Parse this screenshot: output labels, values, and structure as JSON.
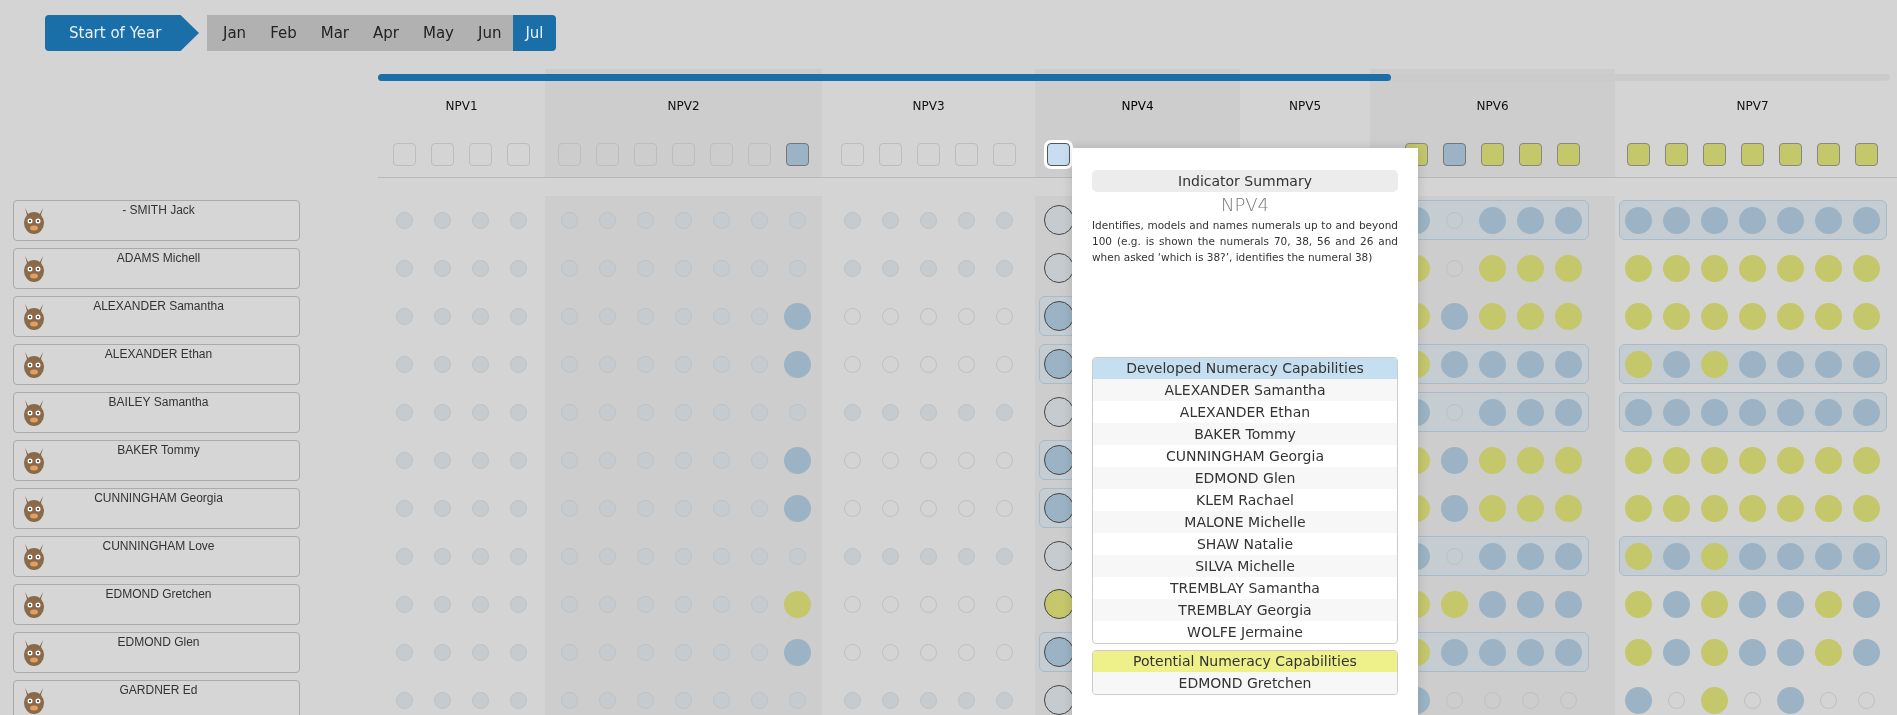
{
  "periods": [
    {
      "label": "Start of Year",
      "kind": "start",
      "selected": false
    },
    {
      "label": "Jan",
      "kind": "month",
      "selected": false
    },
    {
      "label": "Feb",
      "kind": "month",
      "selected": false
    },
    {
      "label": "Mar",
      "kind": "month",
      "selected": false
    },
    {
      "label": "Apr",
      "kind": "month",
      "selected": false
    },
    {
      "label": "May",
      "kind": "month",
      "selected": false
    },
    {
      "label": "Jun",
      "kind": "month",
      "selected": false
    },
    {
      "label": "Jul",
      "kind": "month",
      "selected": true
    }
  ],
  "progress": {
    "level": 0.67
  },
  "indicators": [
    {
      "label": "NPV1",
      "selected": false,
      "checks": [
        {
          "kind": "empty"
        },
        {
          "kind": "empty"
        },
        {
          "kind": "empty"
        },
        {
          "kind": "empty"
        }
      ]
    },
    {
      "label": "NPV2",
      "selected": false,
      "checks": [
        {
          "kind": "empty"
        },
        {
          "kind": "empty"
        },
        {
          "kind": "empty"
        },
        {
          "kind": "empty"
        },
        {
          "kind": "empty"
        },
        {
          "kind": "empty"
        },
        {
          "kind": "developed"
        }
      ]
    },
    {
      "label": "NPV3",
      "selected": false,
      "checks": [
        {
          "kind": "empty"
        },
        {
          "kind": "empty"
        },
        {
          "kind": "empty"
        },
        {
          "kind": "empty"
        },
        {
          "kind": "empty"
        }
      ]
    },
    {
      "label": "NPV4",
      "selected": true,
      "checks": [
        {
          "kind": "empty"
        }
      ]
    },
    {
      "label": "NPV5",
      "selected": false
    },
    {
      "label": "NPV6",
      "selected": false,
      "checks": [
        {
          "kind": "potential"
        },
        {
          "kind": "developed"
        },
        {
          "kind": "potential"
        },
        {
          "kind": "potential"
        },
        {
          "kind": "potential"
        }
      ]
    },
    {
      "label": "NPV7",
      "selected": false,
      "checks": [
        {
          "kind": "potential"
        },
        {
          "kind": "potential"
        },
        {
          "kind": "potential"
        },
        {
          "kind": "potential"
        },
        {
          "kind": "potential"
        },
        {
          "kind": "potential"
        },
        {
          "kind": "potential"
        }
      ]
    }
  ],
  "students": [
    {
      "name": "- SMITH Jack",
      "groups": [
        {
          "band": false,
          "dots": [
            {
              "kind": "inactive"
            },
            {
              "kind": "inactive"
            },
            {
              "kind": "inactive"
            },
            {
              "kind": "inactive"
            }
          ]
        },
        {
          "band": false,
          "dots": [
            {
              "kind": "inactive"
            },
            {
              "kind": "inactive"
            },
            {
              "kind": "inactive"
            },
            {
              "kind": "inactive"
            },
            {
              "kind": "inactive"
            },
            {
              "kind": "inactive"
            },
            {
              "kind": "inactive"
            }
          ]
        },
        {
          "band": false,
          "dots": [
            {
              "kind": "inactive"
            },
            {
              "kind": "inactive"
            },
            {
              "kind": "inactive"
            },
            {
              "kind": "inactive"
            },
            {
              "kind": "inactive"
            }
          ]
        },
        {
          "band": false,
          "dots": [
            {
              "kind": "unassessed"
            }
          ]
        },
        {
          "band": true,
          "dots": [
            {
              "kind": "developed"
            },
            {
              "kind": "empty"
            },
            {
              "kind": "developed"
            },
            {
              "kind": "developed"
            },
            {
              "kind": "developed"
            }
          ]
        },
        {
          "band": true,
          "dots": [
            {
              "kind": "developed"
            },
            {
              "kind": "developed"
            },
            {
              "kind": "developed"
            },
            {
              "kind": "developed"
            },
            {
              "kind": "developed"
            },
            {
              "kind": "developed"
            },
            {
              "kind": "developed"
            }
          ]
        }
      ]
    },
    {
      "name": "ADAMS Michell",
      "groups": [
        {
          "band": false,
          "dots": [
            {
              "kind": "inactive"
            },
            {
              "kind": "inactive"
            },
            {
              "kind": "inactive"
            },
            {
              "kind": "inactive"
            }
          ]
        },
        {
          "band": false,
          "dots": [
            {
              "kind": "inactive"
            },
            {
              "kind": "inactive"
            },
            {
              "kind": "inactive"
            },
            {
              "kind": "inactive"
            },
            {
              "kind": "inactive"
            },
            {
              "kind": "inactive"
            },
            {
              "kind": "inactive"
            }
          ]
        },
        {
          "band": false,
          "dots": [
            {
              "kind": "inactive"
            },
            {
              "kind": "inactive"
            },
            {
              "kind": "inactive"
            },
            {
              "kind": "inactive"
            },
            {
              "kind": "inactive"
            }
          ]
        },
        {
          "band": false,
          "dots": [
            {
              "kind": "unassessed"
            }
          ]
        },
        {
          "band": false,
          "dots": [
            {
              "kind": "potential"
            },
            {
              "kind": "empty"
            },
            {
              "kind": "potential"
            },
            {
              "kind": "potential"
            },
            {
              "kind": "potential"
            }
          ]
        },
        {
          "band": false,
          "dots": [
            {
              "kind": "potential"
            },
            {
              "kind": "potential"
            },
            {
              "kind": "potential"
            },
            {
              "kind": "potential"
            },
            {
              "kind": "potential"
            },
            {
              "kind": "potential"
            },
            {
              "kind": "potential"
            }
          ]
        }
      ]
    },
    {
      "name": "ALEXANDER Samantha",
      "groups": [
        {
          "band": false,
          "dots": [
            {
              "kind": "inactive"
            },
            {
              "kind": "inactive"
            },
            {
              "kind": "inactive"
            },
            {
              "kind": "inactive"
            }
          ]
        },
        {
          "band": false,
          "dots": [
            {
              "kind": "inactive"
            },
            {
              "kind": "inactive"
            },
            {
              "kind": "inactive"
            },
            {
              "kind": "inactive"
            },
            {
              "kind": "inactive"
            },
            {
              "kind": "inactive"
            },
            {
              "kind": "developed"
            }
          ]
        },
        {
          "band": false,
          "dots": [
            {
              "kind": "empty"
            },
            {
              "kind": "empty"
            },
            {
              "kind": "empty"
            },
            {
              "kind": "empty"
            },
            {
              "kind": "empty"
            }
          ]
        },
        {
          "band": true,
          "dots": [
            {
              "kind": "developed"
            }
          ]
        },
        {
          "band": false,
          "dots": [
            {
              "kind": "potential"
            },
            {
              "kind": "developed"
            },
            {
              "kind": "potential"
            },
            {
              "kind": "potential"
            },
            {
              "kind": "potential"
            }
          ]
        },
        {
          "band": false,
          "dots": [
            {
              "kind": "potential"
            },
            {
              "kind": "potential"
            },
            {
              "kind": "potential"
            },
            {
              "kind": "potential"
            },
            {
              "kind": "potential"
            },
            {
              "kind": "potential"
            },
            {
              "kind": "potential"
            }
          ]
        }
      ]
    },
    {
      "name": "ALEXANDER Ethan",
      "groups": [
        {
          "band": false,
          "dots": [
            {
              "kind": "inactive"
            },
            {
              "kind": "inactive"
            },
            {
              "kind": "inactive"
            },
            {
              "kind": "inactive"
            }
          ]
        },
        {
          "band": false,
          "dots": [
            {
              "kind": "inactive"
            },
            {
              "kind": "inactive"
            },
            {
              "kind": "inactive"
            },
            {
              "kind": "inactive"
            },
            {
              "kind": "inactive"
            },
            {
              "kind": "inactive"
            },
            {
              "kind": "developed"
            }
          ]
        },
        {
          "band": false,
          "dots": [
            {
              "kind": "empty"
            },
            {
              "kind": "empty"
            },
            {
              "kind": "empty"
            },
            {
              "kind": "empty"
            },
            {
              "kind": "empty"
            }
          ]
        },
        {
          "band": true,
          "dots": [
            {
              "kind": "developed"
            }
          ]
        },
        {
          "band": true,
          "dots": [
            {
              "kind": "potential"
            },
            {
              "kind": "developed"
            },
            {
              "kind": "developed"
            },
            {
              "kind": "developed"
            },
            {
              "kind": "developed"
            }
          ]
        },
        {
          "band": true,
          "dots": [
            {
              "kind": "potential"
            },
            {
              "kind": "developed"
            },
            {
              "kind": "potential"
            },
            {
              "kind": "developed"
            },
            {
              "kind": "developed"
            },
            {
              "kind": "developed"
            },
            {
              "kind": "developed"
            }
          ]
        }
      ]
    },
    {
      "name": "BAILEY Samantha",
      "groups": [
        {
          "band": false,
          "dots": [
            {
              "kind": "inactive"
            },
            {
              "kind": "inactive"
            },
            {
              "kind": "inactive"
            },
            {
              "kind": "inactive"
            }
          ]
        },
        {
          "band": false,
          "dots": [
            {
              "kind": "inactive"
            },
            {
              "kind": "inactive"
            },
            {
              "kind": "inactive"
            },
            {
              "kind": "inactive"
            },
            {
              "kind": "inactive"
            },
            {
              "kind": "inactive"
            },
            {
              "kind": "inactive"
            }
          ]
        },
        {
          "band": false,
          "dots": [
            {
              "kind": "inactive"
            },
            {
              "kind": "inactive"
            },
            {
              "kind": "inactive"
            },
            {
              "kind": "inactive"
            },
            {
              "kind": "inactive"
            }
          ]
        },
        {
          "band": false,
          "dots": [
            {
              "kind": "unassessed"
            }
          ]
        },
        {
          "band": true,
          "dots": [
            {
              "kind": "developed"
            },
            {
              "kind": "empty"
            },
            {
              "kind": "developed"
            },
            {
              "kind": "developed"
            },
            {
              "kind": "developed"
            }
          ]
        },
        {
          "band": true,
          "dots": [
            {
              "kind": "developed"
            },
            {
              "kind": "developed"
            },
            {
              "kind": "developed"
            },
            {
              "kind": "developed"
            },
            {
              "kind": "developed"
            },
            {
              "kind": "developed"
            },
            {
              "kind": "developed"
            }
          ]
        }
      ]
    },
    {
      "name": "BAKER Tommy",
      "groups": [
        {
          "band": false,
          "dots": [
            {
              "kind": "inactive"
            },
            {
              "kind": "inactive"
            },
            {
              "kind": "inactive"
            },
            {
              "kind": "inactive"
            }
          ]
        },
        {
          "band": false,
          "dots": [
            {
              "kind": "inactive"
            },
            {
              "kind": "inactive"
            },
            {
              "kind": "inactive"
            },
            {
              "kind": "inactive"
            },
            {
              "kind": "inactive"
            },
            {
              "kind": "inactive"
            },
            {
              "kind": "developed"
            }
          ]
        },
        {
          "band": false,
          "dots": [
            {
              "kind": "empty"
            },
            {
              "kind": "empty"
            },
            {
              "kind": "empty"
            },
            {
              "kind": "empty"
            },
            {
              "kind": "empty"
            }
          ]
        },
        {
          "band": true,
          "dots": [
            {
              "kind": "developed"
            }
          ]
        },
        {
          "band": false,
          "dots": [
            {
              "kind": "potential"
            },
            {
              "kind": "developed"
            },
            {
              "kind": "potential"
            },
            {
              "kind": "potential"
            },
            {
              "kind": "potential"
            }
          ]
        },
        {
          "band": false,
          "dots": [
            {
              "kind": "potential"
            },
            {
              "kind": "potential"
            },
            {
              "kind": "potential"
            },
            {
              "kind": "potential"
            },
            {
              "kind": "potential"
            },
            {
              "kind": "potential"
            },
            {
              "kind": "potential"
            }
          ]
        }
      ]
    },
    {
      "name": "CUNNINGHAM Georgia",
      "groups": [
        {
          "band": false,
          "dots": [
            {
              "kind": "inactive"
            },
            {
              "kind": "inactive"
            },
            {
              "kind": "inactive"
            },
            {
              "kind": "inactive"
            }
          ]
        },
        {
          "band": false,
          "dots": [
            {
              "kind": "inactive"
            },
            {
              "kind": "inactive"
            },
            {
              "kind": "inactive"
            },
            {
              "kind": "inactive"
            },
            {
              "kind": "inactive"
            },
            {
              "kind": "inactive"
            },
            {
              "kind": "developed"
            }
          ]
        },
        {
          "band": false,
          "dots": [
            {
              "kind": "empty"
            },
            {
              "kind": "empty"
            },
            {
              "kind": "empty"
            },
            {
              "kind": "empty"
            },
            {
              "kind": "empty"
            }
          ]
        },
        {
          "band": true,
          "dots": [
            {
              "kind": "developed"
            }
          ]
        },
        {
          "band": false,
          "dots": [
            {
              "kind": "potential"
            },
            {
              "kind": "developed"
            },
            {
              "kind": "potential"
            },
            {
              "kind": "potential"
            },
            {
              "kind": "potential"
            }
          ]
        },
        {
          "band": false,
          "dots": [
            {
              "kind": "potential"
            },
            {
              "kind": "potential"
            },
            {
              "kind": "potential"
            },
            {
              "kind": "potential"
            },
            {
              "kind": "potential"
            },
            {
              "kind": "potential"
            },
            {
              "kind": "potential"
            }
          ]
        }
      ]
    },
    {
      "name": "CUNNINGHAM Love",
      "groups": [
        {
          "band": false,
          "dots": [
            {
              "kind": "inactive"
            },
            {
              "kind": "inactive"
            },
            {
              "kind": "inactive"
            },
            {
              "kind": "inactive"
            }
          ]
        },
        {
          "band": false,
          "dots": [
            {
              "kind": "inactive"
            },
            {
              "kind": "inactive"
            },
            {
              "kind": "inactive"
            },
            {
              "kind": "inactive"
            },
            {
              "kind": "inactive"
            },
            {
              "kind": "inactive"
            },
            {
              "kind": "inactive"
            }
          ]
        },
        {
          "band": false,
          "dots": [
            {
              "kind": "inactive"
            },
            {
              "kind": "inactive"
            },
            {
              "kind": "inactive"
            },
            {
              "kind": "inactive"
            },
            {
              "kind": "inactive"
            }
          ]
        },
        {
          "band": false,
          "dots": [
            {
              "kind": "unassessed"
            }
          ]
        },
        {
          "band": true,
          "dots": [
            {
              "kind": "developed"
            },
            {
              "kind": "empty"
            },
            {
              "kind": "developed"
            },
            {
              "kind": "developed"
            },
            {
              "kind": "developed"
            }
          ]
        },
        {
          "band": true,
          "dots": [
            {
              "kind": "potential"
            },
            {
              "kind": "developed"
            },
            {
              "kind": "potential"
            },
            {
              "kind": "developed"
            },
            {
              "kind": "developed"
            },
            {
              "kind": "developed"
            },
            {
              "kind": "developed"
            }
          ]
        }
      ]
    },
    {
      "name": "EDMOND Gretchen",
      "groups": [
        {
          "band": false,
          "dots": [
            {
              "kind": "inactive"
            },
            {
              "kind": "inactive"
            },
            {
              "kind": "inactive"
            },
            {
              "kind": "inactive"
            }
          ]
        },
        {
          "band": false,
          "dots": [
            {
              "kind": "inactive"
            },
            {
              "kind": "inactive"
            },
            {
              "kind": "inactive"
            },
            {
              "kind": "inactive"
            },
            {
              "kind": "inactive"
            },
            {
              "kind": "inactive"
            },
            {
              "kind": "potential"
            }
          ]
        },
        {
          "band": false,
          "dots": [
            {
              "kind": "empty"
            },
            {
              "kind": "empty"
            },
            {
              "kind": "empty"
            },
            {
              "kind": "empty"
            },
            {
              "kind": "empty"
            }
          ]
        },
        {
          "band": false,
          "dots": [
            {
              "kind": "potential"
            }
          ]
        },
        {
          "band": false,
          "dots": [
            {
              "kind": "potential"
            },
            {
              "kind": "potential"
            },
            {
              "kind": "developed"
            },
            {
              "kind": "developed"
            },
            {
              "kind": "developed"
            }
          ]
        },
        {
          "band": false,
          "dots": [
            {
              "kind": "potential"
            },
            {
              "kind": "developed"
            },
            {
              "kind": "potential"
            },
            {
              "kind": "developed"
            },
            {
              "kind": "developed"
            },
            {
              "kind": "potential"
            },
            {
              "kind": "developed"
            }
          ]
        }
      ]
    },
    {
      "name": "EDMOND Glen",
      "groups": [
        {
          "band": false,
          "dots": [
            {
              "kind": "inactive"
            },
            {
              "kind": "inactive"
            },
            {
              "kind": "inactive"
            },
            {
              "kind": "inactive"
            }
          ]
        },
        {
          "band": false,
          "dots": [
            {
              "kind": "inactive"
            },
            {
              "kind": "inactive"
            },
            {
              "kind": "inactive"
            },
            {
              "kind": "inactive"
            },
            {
              "kind": "inactive"
            },
            {
              "kind": "inactive"
            },
            {
              "kind": "developed"
            }
          ]
        },
        {
          "band": false,
          "dots": [
            {
              "kind": "empty"
            },
            {
              "kind": "empty"
            },
            {
              "kind": "empty"
            },
            {
              "kind": "empty"
            },
            {
              "kind": "empty"
            }
          ]
        },
        {
          "band": true,
          "dots": [
            {
              "kind": "developed"
            }
          ]
        },
        {
          "band": true,
          "dots": [
            {
              "kind": "potential"
            },
            {
              "kind": "developed"
            },
            {
              "kind": "developed"
            },
            {
              "kind": "developed"
            },
            {
              "kind": "developed"
            }
          ]
        },
        {
          "band": false,
          "dots": [
            {
              "kind": "potential"
            },
            {
              "kind": "developed"
            },
            {
              "kind": "potential"
            },
            {
              "kind": "developed"
            },
            {
              "kind": "developed"
            },
            {
              "kind": "potential"
            },
            {
              "kind": "developed"
            }
          ]
        }
      ]
    },
    {
      "name": "GARDNER Ed",
      "groups": [
        {
          "band": false,
          "dots": [
            {
              "kind": "inactive"
            },
            {
              "kind": "inactive"
            },
            {
              "kind": "inactive"
            },
            {
              "kind": "inactive"
            }
          ]
        },
        {
          "band": false,
          "dots": [
            {
              "kind": "inactive"
            },
            {
              "kind": "inactive"
            },
            {
              "kind": "inactive"
            },
            {
              "kind": "inactive"
            },
            {
              "kind": "inactive"
            },
            {
              "kind": "inactive"
            },
            {
              "kind": "inactive"
            }
          ]
        },
        {
          "band": false,
          "dots": [
            {
              "kind": "inactive"
            },
            {
              "kind": "inactive"
            },
            {
              "kind": "inactive"
            },
            {
              "kind": "inactive"
            },
            {
              "kind": "inactive"
            }
          ]
        },
        {
          "band": false,
          "dots": [
            {
              "kind": "unassessed"
            }
          ]
        },
        {
          "band": false,
          "dots": [
            {
              "kind": "developed"
            },
            {
              "kind": "empty"
            },
            {
              "kind": "empty"
            },
            {
              "kind": "empty"
            },
            {
              "kind": "empty"
            }
          ]
        },
        {
          "band": false,
          "dots": [
            {
              "kind": "developed"
            },
            {
              "kind": "empty"
            },
            {
              "kind": "potential"
            },
            {
              "kind": "empty"
            },
            {
              "kind": "developed"
            },
            {
              "kind": "empty"
            },
            {
              "kind": "empty"
            }
          ]
        }
      ]
    }
  ],
  "summary": {
    "title": "Indicator Summary",
    "indicator": "NPV4",
    "description": "Identifies, models and names numerals up to and beyond 100 (e.g. is shown the numerals 70, 38, 56 and 26 and when asked ‘which is 38?’, identifies the numeral 38)",
    "lists": [
      {
        "kind": "developed",
        "heading": "Developed Numeracy Capabilities",
        "names": [
          "ALEXANDER Samantha",
          "ALEXANDER Ethan",
          "BAKER Tommy",
          "CUNNINGHAM Georgia",
          "EDMOND Glen",
          "KLEM Rachael",
          "MALONE Michelle",
          "SHAW Natalie",
          "SILVA Michelle",
          "TREMBLAY Samantha",
          "TREMBLAY Georgia",
          "WOLFE Jermaine"
        ]
      },
      {
        "kind": "potential",
        "heading": "Potential Numeracy Capabilities",
        "names": [
          "EDMOND Gretchen"
        ]
      }
    ]
  }
}
